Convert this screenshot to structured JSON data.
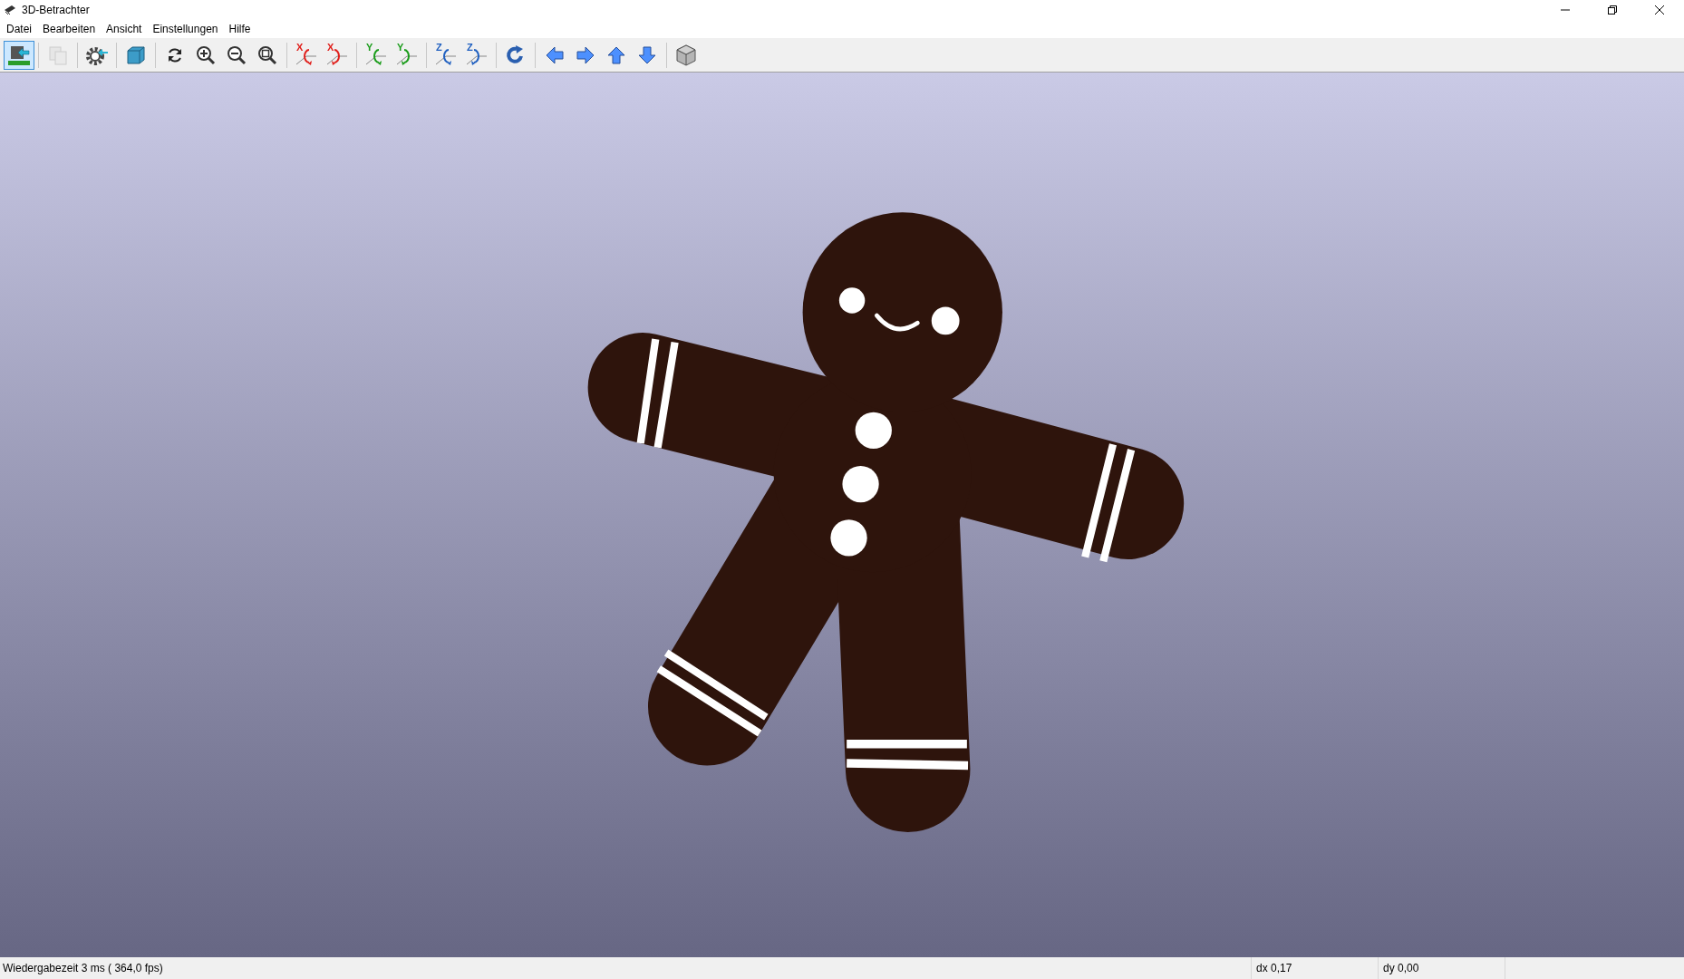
{
  "window": {
    "title": "3D-Betrachter"
  },
  "menu": [
    "Datei",
    "Bearbeiten",
    "Ansicht",
    "Einstellungen",
    "Hilfe"
  ],
  "toolbar": [
    [
      {
        "kind": "board",
        "selected": true
      }
    ],
    [
      {
        "kind": "copy",
        "selected": false,
        "disabled": true
      }
    ],
    [
      {
        "kind": "settings",
        "selected": false
      }
    ],
    [
      {
        "kind": "cube",
        "selected": false
      }
    ],
    [
      {
        "kind": "refresh",
        "selected": false
      },
      {
        "kind": "zoom-in",
        "selected": false
      },
      {
        "kind": "zoom-out",
        "selected": false
      },
      {
        "kind": "zoom-fit",
        "selected": false
      }
    ],
    [
      {
        "kind": "rot-x",
        "axis": "X",
        "selected": false
      },
      {
        "kind": "rot-x-rev",
        "axis": "X",
        "selected": false
      }
    ],
    [
      {
        "kind": "rot-y",
        "axis": "Y",
        "selected": false
      },
      {
        "kind": "rot-y-rev",
        "axis": "Y",
        "selected": false
      }
    ],
    [
      {
        "kind": "rot-z",
        "axis": "Z",
        "selected": false
      },
      {
        "kind": "rot-z-rev",
        "axis": "Z",
        "selected": false
      }
    ],
    [
      {
        "kind": "redo",
        "selected": false
      }
    ],
    [
      {
        "kind": "left",
        "selected": false
      },
      {
        "kind": "right",
        "selected": false
      },
      {
        "kind": "up",
        "selected": false
      },
      {
        "kind": "down",
        "selected": false
      }
    ],
    [
      {
        "kind": "gray-cube",
        "selected": false
      }
    ]
  ],
  "status_bar": {
    "render_time": "Wiedergabezeit 3 ms ( 364,0 fps)",
    "dx": "dx 0,17",
    "dy": "dy 0,00"
  }
}
